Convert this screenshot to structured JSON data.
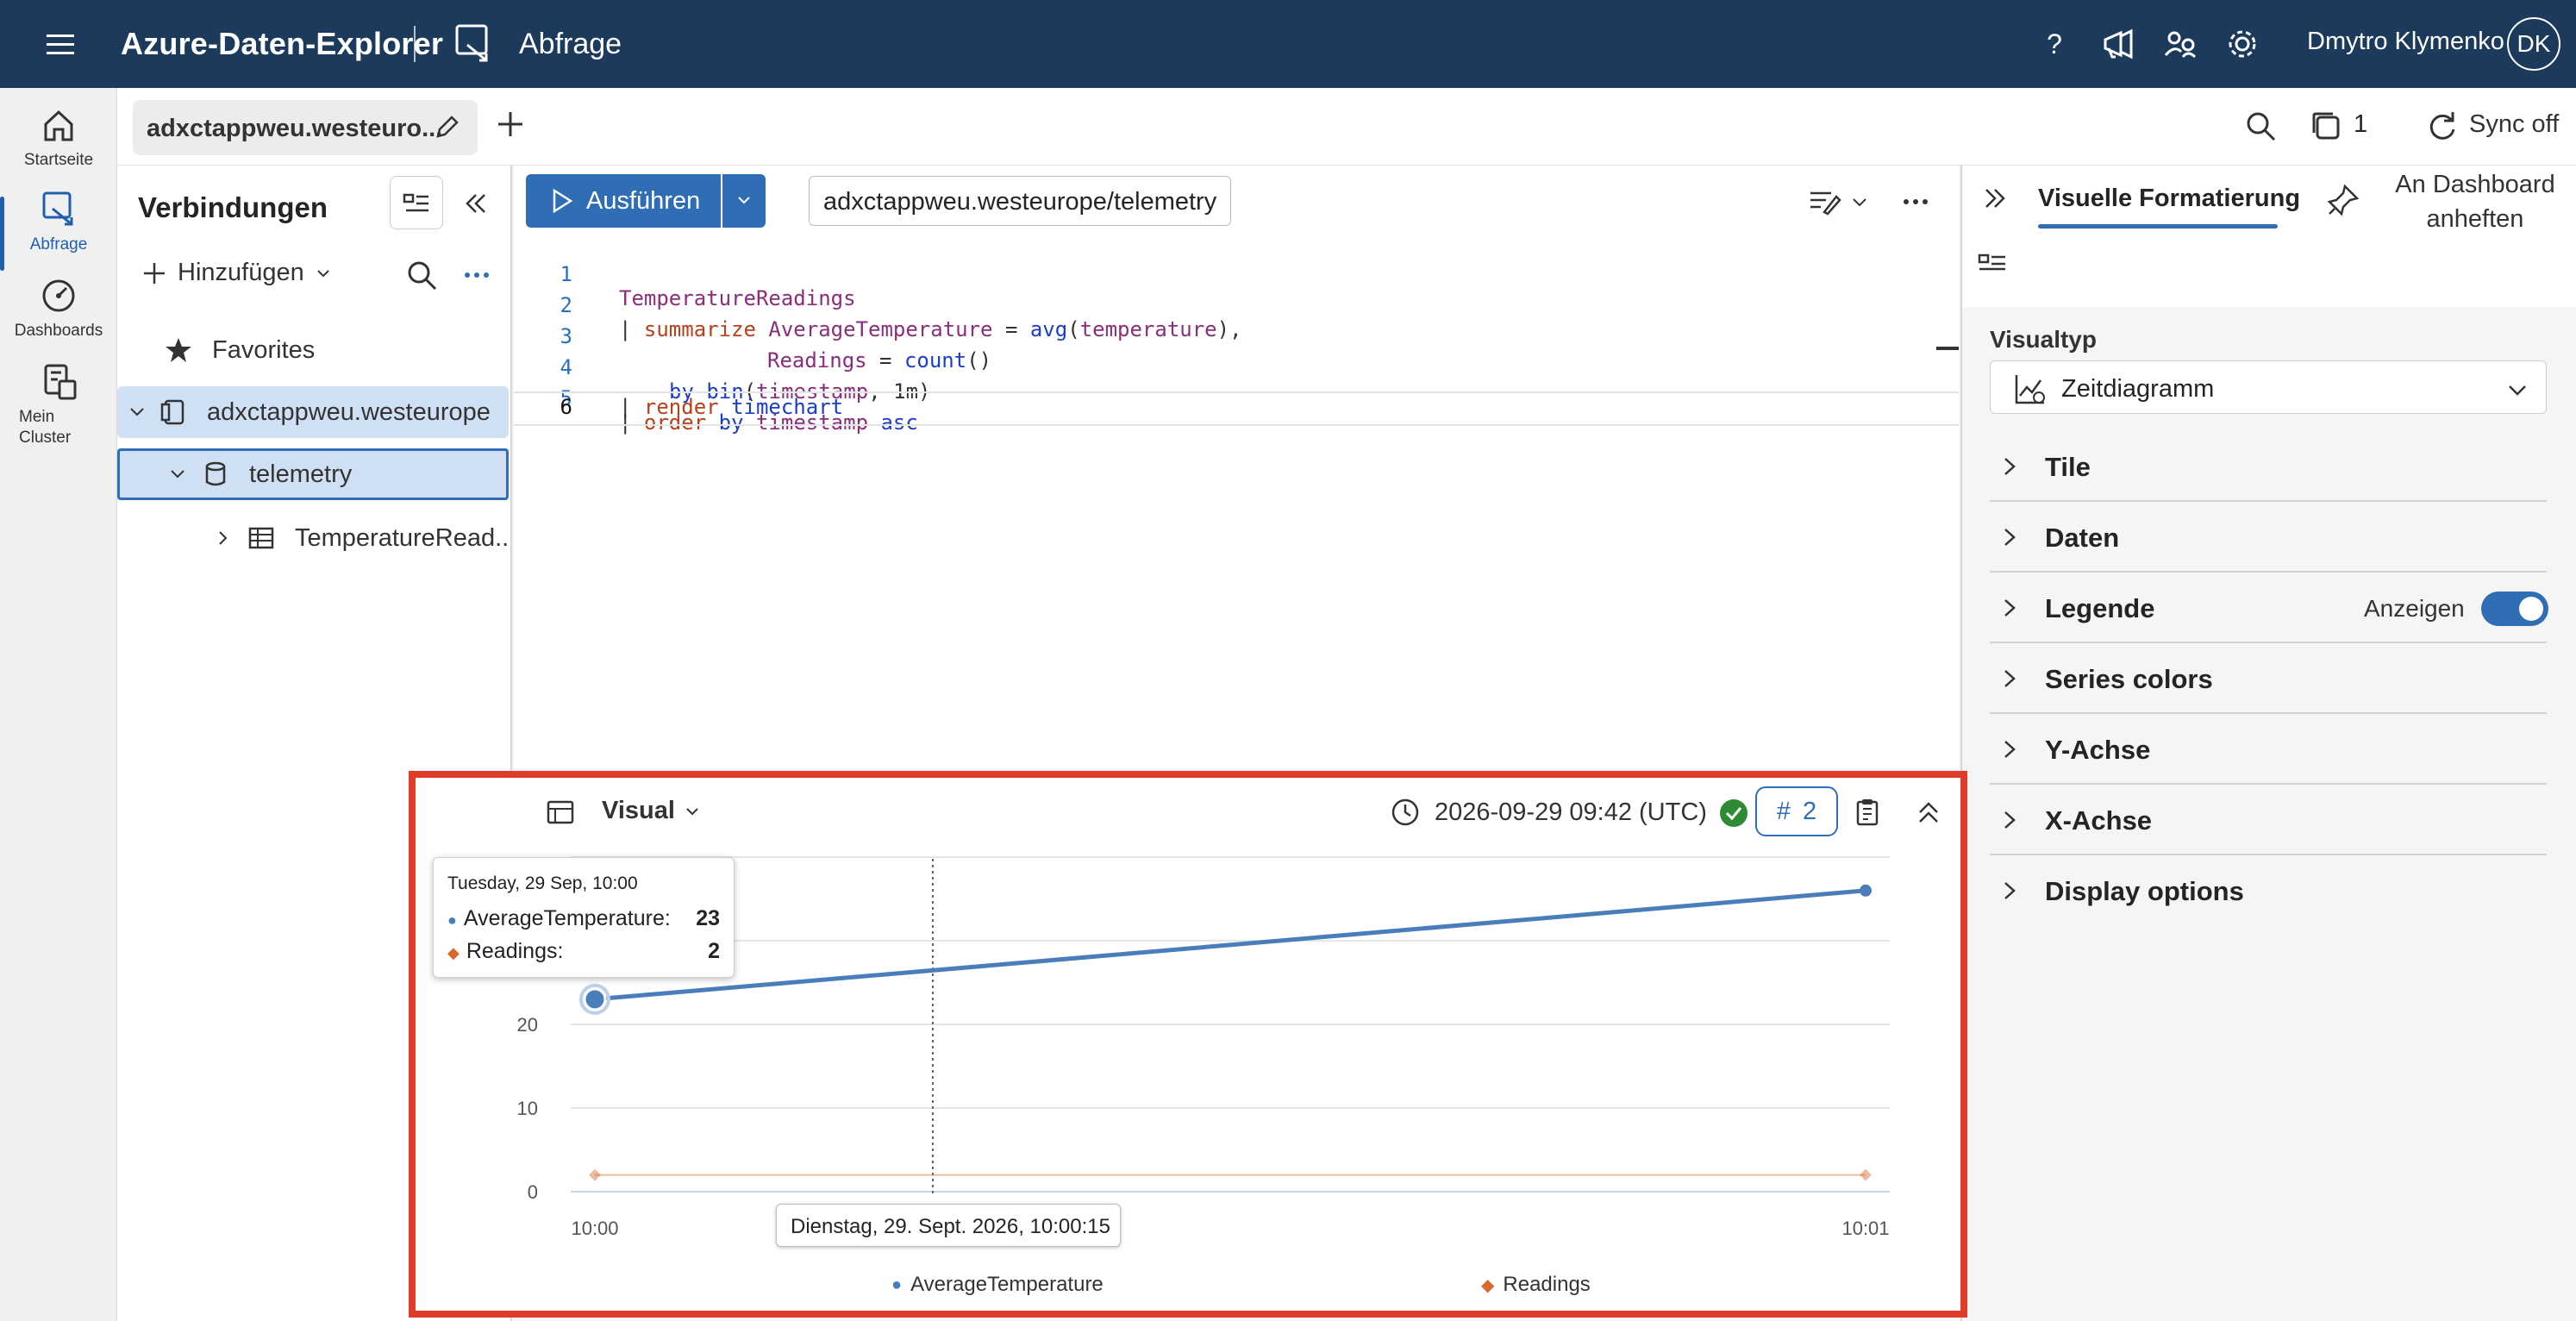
{
  "header": {
    "app_title": "Azure-Daten-Explorer",
    "page_label": "Abfrage",
    "user_name": "Dmytro Klymenko",
    "user_initials": "DK"
  },
  "leftnav": {
    "items": [
      {
        "label": "Startseite",
        "icon": "home-icon"
      },
      {
        "label": "Abfrage",
        "icon": "query-icon",
        "active": true
      },
      {
        "label": "Dashboards",
        "icon": "dashboard-icon"
      },
      {
        "label": "Mein Cluster",
        "icon": "cluster-icon"
      }
    ]
  },
  "tabs": {
    "query_tab_label": "adxctappweu.westeuro...",
    "open_count": "1",
    "sync_label": "Sync off"
  },
  "connections": {
    "title": "Verbindungen",
    "add_label": "Hinzufügen",
    "tree": [
      {
        "label": "Favorites",
        "icon": "star-icon"
      },
      {
        "label": "adxctappweu.westeurope",
        "icon": "cluster-icon"
      },
      {
        "label": "telemetry",
        "icon": "database-icon"
      },
      {
        "label": "TemperatureRead...",
        "icon": "table-icon"
      }
    ]
  },
  "editor": {
    "run_label": "Ausführen",
    "database": "adxctappweu.westeurope/telemetry",
    "lines": [
      "1",
      "2",
      "3",
      "4",
      "5",
      "6"
    ],
    "code": {
      "l1": "TemperatureReadings",
      "l2_pipe": "| ",
      "l2_op": "summarize ",
      "l2_col": "AverageTemperature",
      "l2_eq": " = ",
      "l2_fn": "avg",
      "l2_arg": "temperature",
      "l2_end": "),",
      "l3_col": "Readings",
      "l3_eq": " = ",
      "l3_fn": "count",
      "l3_end": "()",
      "l4_by": "by ",
      "l4_fn": "bin",
      "l4_arg": "timestamp",
      "l4_end": ", 1m)",
      "l5_pipe": "| ",
      "l5_op": "order ",
      "l5_by": "by ",
      "l5_col": "timestamp",
      "l5_asc": " asc",
      "l6_pipe": "| ",
      "l6_op": "render ",
      "l6_fn": "timechart"
    }
  },
  "format_panel": {
    "tab_label": "Visuelle Formatierung",
    "pin_label": "An Dashboard anheften",
    "visual_type_label": "Visualtyp",
    "visual_type_value": "Zeitdiagramm",
    "sections": [
      "Tile",
      "Daten",
      "Legende",
      "Series colors",
      "Y-Achse",
      "X-Achse",
      "Display options"
    ],
    "legend_toggle_label": "Anzeigen",
    "legend_toggle_on": true
  },
  "results": {
    "view_label": "Visual",
    "timestamp": "2026-09-29 09:42 (UTC)",
    "row_count": "2",
    "tooltip": {
      "date": "Tuesday, 29 Sep, 10:00",
      "rows": [
        {
          "name": "AverageTemperature:",
          "value": "23"
        },
        {
          "name": "Readings:",
          "value": "2"
        }
      ]
    },
    "crosshair_label": "Dienstag, 29. Sept. 2026, 10:00:15"
  },
  "chart_data": {
    "type": "line",
    "x": [
      "10:00",
      "10:01"
    ],
    "series": [
      {
        "name": "AverageTemperature",
        "values": [
          23,
          36
        ],
        "color": "#4a7ebb"
      },
      {
        "name": "Readings",
        "values": [
          2,
          2
        ],
        "color": "#d8692c"
      }
    ],
    "ylim": [
      0,
      40
    ],
    "yticks": [
      0,
      10,
      20
    ],
    "grid": true,
    "legend": "bottom"
  }
}
